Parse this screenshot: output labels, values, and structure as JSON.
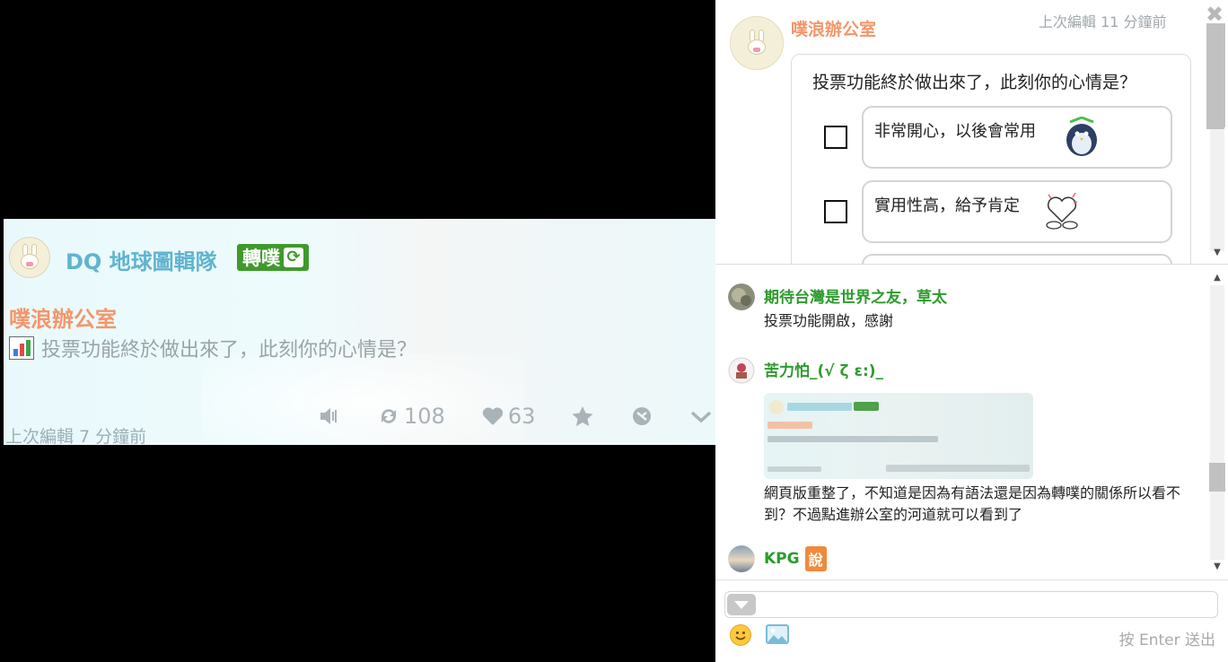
{
  "left_card": {
    "owner": "DQ 地球圖輯隊",
    "badge": "轉噗",
    "group": "噗浪辦公室",
    "content": "投票功能終於做出來了，此刻你的心情是？",
    "time": "上次編輯 7 分鐘前",
    "replurks": "108",
    "likes": "63"
  },
  "panel": {
    "owner": "噗浪辦公室",
    "edited": "上次編輯 11 分鐘前",
    "close": "✖",
    "poll": {
      "question": "投票功能終於做出來了，此刻你的心情是？",
      "options": [
        {
          "label": "非常開心，以後會常用"
        },
        {
          "label": "實用性高，給予肯定"
        }
      ]
    }
  },
  "responses": [
    {
      "name": "期待台灣是世界之友，草太",
      "text": "投票功能開啟，感謝"
    },
    {
      "name": "苦力怕_(√ ζ ε:)_",
      "text": "網頁版重整了，不知道是因為有語法還是因為轉噗的關係所以看不到？不過點進辦公室的河道就可以看到了"
    },
    {
      "name": "KPG",
      "badge": "說",
      "text": ""
    }
  ],
  "composer": {
    "send_hint": "按 Enter 送出"
  },
  "colors": {
    "owner_blue": "#5fb4cf",
    "group_orange": "#f4966a",
    "badge_green": "#3e9a2b",
    "name_green": "#2d9b2d"
  }
}
